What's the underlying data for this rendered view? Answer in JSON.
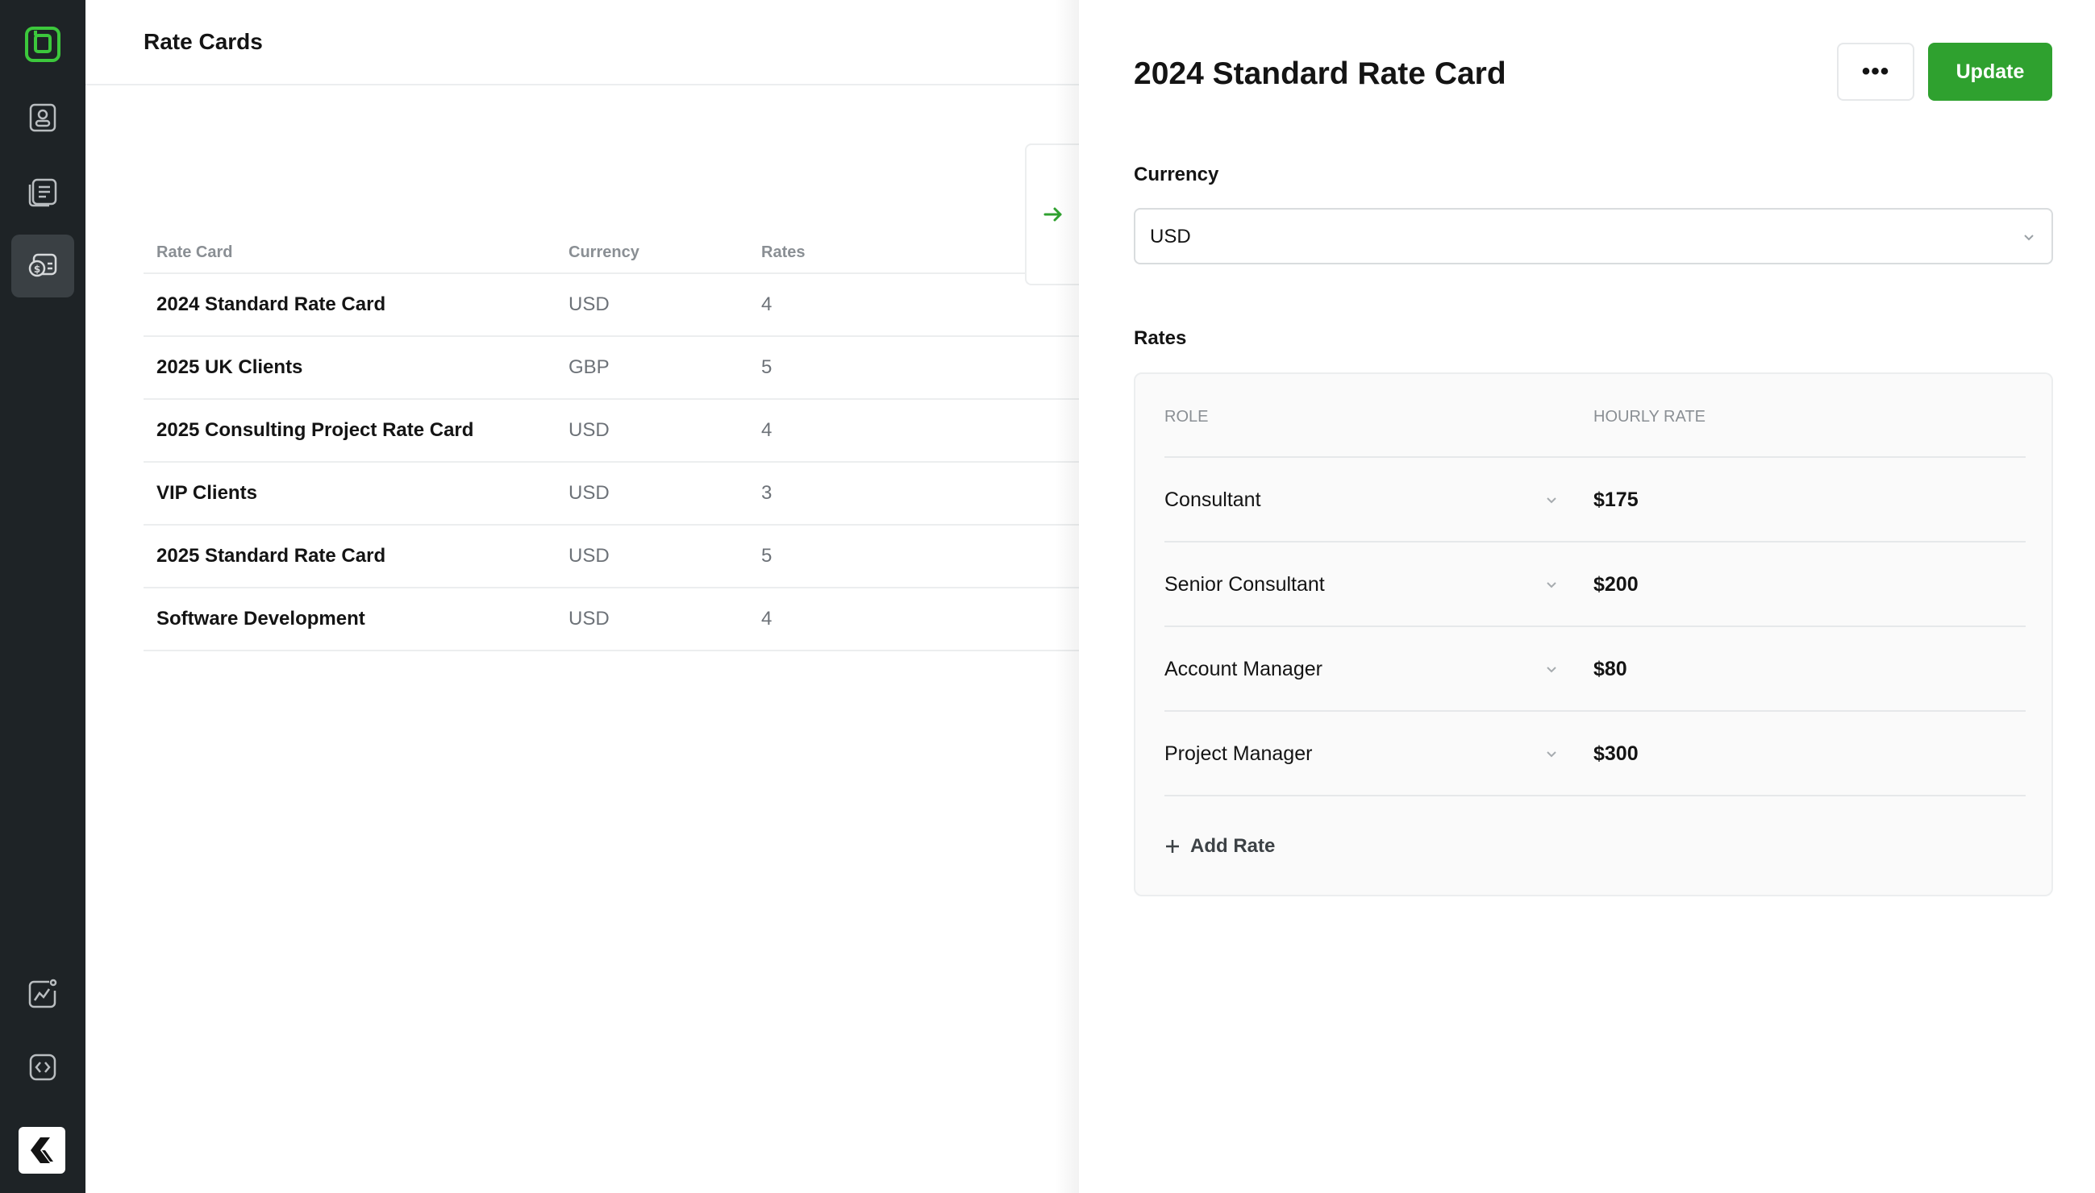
{
  "page": {
    "title": "Rate Cards"
  },
  "sidebar": {
    "items": [
      {
        "icon": "contacts-icon"
      },
      {
        "icon": "documents-icon"
      },
      {
        "icon": "rate-cards-icon",
        "active": true
      },
      {
        "icon": "analytics-icon"
      },
      {
        "icon": "code-icon"
      }
    ]
  },
  "table": {
    "headers": {
      "name": "Rate Card",
      "currency": "Currency",
      "rates": "Rates"
    },
    "rows": [
      {
        "name": "2024 Standard Rate Card",
        "currency": "USD",
        "rates": "4"
      },
      {
        "name": "2025 UK Clients",
        "currency": "GBP",
        "rates": "5"
      },
      {
        "name": "2025 Consulting Project Rate Card",
        "currency": "USD",
        "rates": "4"
      },
      {
        "name": "VIP Clients",
        "currency": "USD",
        "rates": "3"
      },
      {
        "name": "2025 Standard Rate Card",
        "currency": "USD",
        "rates": "5"
      },
      {
        "name": "Software Development",
        "currency": "USD",
        "rates": "4"
      }
    ]
  },
  "drawer": {
    "title": "2024 Standard Rate Card",
    "more_label": "•••",
    "update_label": "Update",
    "currency_label": "Currency",
    "currency_value": "USD",
    "rates_label": "Rates",
    "rates_headers": {
      "role": "ROLE",
      "rate": "HOURLY RATE"
    },
    "rates": [
      {
        "role": "Consultant",
        "rate": "$175"
      },
      {
        "role": "Senior Consultant",
        "rate": "$200"
      },
      {
        "role": "Account Manager",
        "rate": "$80"
      },
      {
        "role": "Project Manager",
        "rate": "$300"
      }
    ],
    "add_rate_label": "Add Rate"
  },
  "colors": {
    "accent": "#2fa12f",
    "sidebar_bg": "#1e2326"
  }
}
